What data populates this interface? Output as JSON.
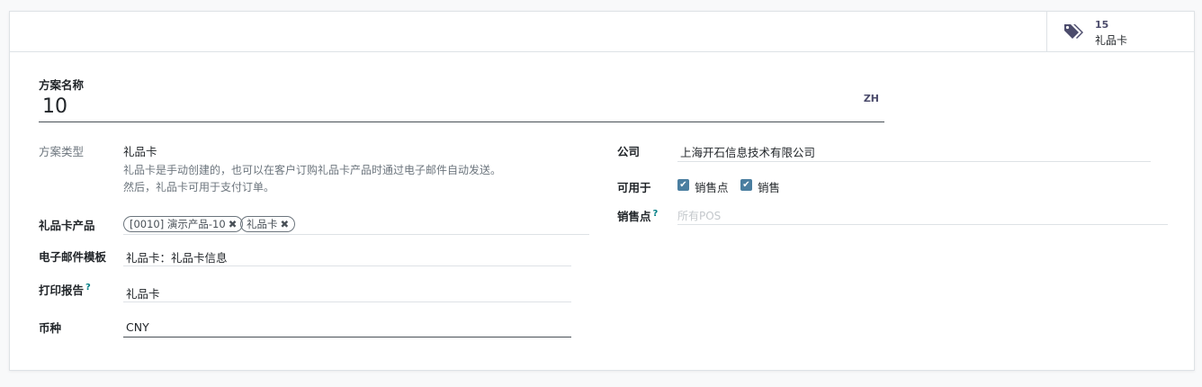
{
  "smart_button": {
    "value": "15",
    "label": "礼品卡",
    "icon": "tags-icon"
  },
  "program_name": {
    "label": "方案名称",
    "value": "10",
    "lang": "ZH"
  },
  "program_type": {
    "label": "方案类型",
    "value": "礼品卡",
    "description_line1": "礼品卡是手动创建的，也可以在客户订购礼品卡产品时通过电子邮件自动发送。",
    "description_line2": "然后，礼品卡可用于支付订单。"
  },
  "gift_card_products": {
    "label": "礼品卡产品",
    "tags": [
      "[0010] 演示产品-10",
      "礼品卡"
    ],
    "remove_glyph": "✖"
  },
  "email_template": {
    "label": "电子邮件模板",
    "value": "礼品卡：礼品卡信息"
  },
  "print_report": {
    "label": "打印报告",
    "help": "?",
    "value": "礼品卡"
  },
  "currency": {
    "label": "币种",
    "value": "CNY"
  },
  "company": {
    "label": "公司",
    "value": "上海开石信息技术有限公司"
  },
  "available_on": {
    "label": "可用于",
    "options": [
      {
        "label": "销售点",
        "checked": true
      },
      {
        "label": "销售",
        "checked": true
      }
    ]
  },
  "pos": {
    "label": "销售点",
    "help": "?",
    "placeholder": "所有POS"
  },
  "colors": {
    "accent": "#017e84",
    "checkbox": "#4a7ea0",
    "tag_icon": "#4c4c6c"
  }
}
